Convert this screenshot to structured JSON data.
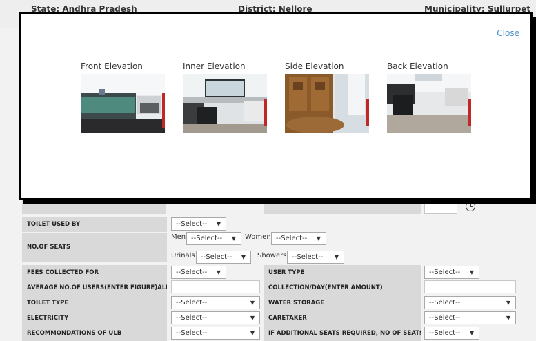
{
  "header": {
    "state": "State: Andhra Pradesh",
    "district": "District: Nellore",
    "municipality": "Municipality: Sullurpet"
  },
  "modal": {
    "close_label": "Close",
    "elevations": [
      {
        "caption": "Front Elevation"
      },
      {
        "caption": "Inner Elevation"
      },
      {
        "caption": "Side Elevation"
      },
      {
        "caption": "Back Elevation"
      }
    ]
  },
  "form": {
    "toilet_used_by": {
      "label": "TOILET USED BY",
      "value": "--Select--"
    },
    "no_of_seats": {
      "label": "NO.OF SEATS",
      "men_label": "Men",
      "men_value": "--Select--",
      "women_label": "Women",
      "women_value": "--Select--",
      "urinals_label": "Urinals",
      "urinals_value": "--Select--",
      "showers_label": "Showers",
      "showers_value": "--Select--"
    },
    "fees_collected_for": {
      "label": "FEES COLLECTED FOR",
      "value": "--Select--"
    },
    "user_type": {
      "label": "USER TYPE",
      "value": "--Select--"
    },
    "avg_users": {
      "label": "AVERAGE NO.OF USERS(ENTER FIGURE)ALL",
      "value": ""
    },
    "collection_day": {
      "label": "COLLECTION/DAY(ENTER AMOUNT)",
      "value": ""
    },
    "toilet_type": {
      "label": "TOILET TYPE",
      "value": "--Select--"
    },
    "water_storage": {
      "label": "WATER STORAGE",
      "value": "--Select--"
    },
    "electricity": {
      "label": "ELECTRICITY",
      "value": "--Select--"
    },
    "caretaker": {
      "label": "CARETAKER",
      "value": "--Select--"
    },
    "recommendations": {
      "label": "RECOMMONDATIONS OF ULB",
      "value": "--Select--"
    },
    "additional_seats": {
      "label": "IF ADDITIONAL SEATS REQUIRED, NO OF SEATS",
      "value": "--Select--"
    }
  },
  "colors": {
    "link": "#4a90c8",
    "label_bg": "#d9d9d9",
    "page_bg": "#f2f2f2"
  },
  "icons": {
    "clock": "clock-icon",
    "dropdown": "chevron-down-icon"
  }
}
